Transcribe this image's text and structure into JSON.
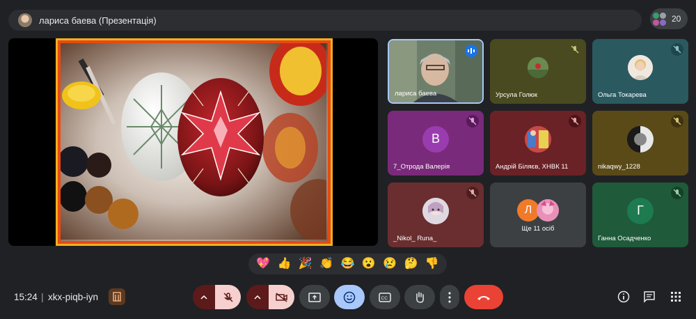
{
  "meeting": {
    "title": "лариса баева (Презентація)",
    "participant_count": "20",
    "time": "15:24",
    "separator": "|",
    "code": "xkx-piqb-iyn"
  },
  "tiles": [
    {
      "name": "лариса баева",
      "mic": "speaking-icon"
    },
    {
      "name": "Урсула Голюк",
      "mic": "mic-off-icon"
    },
    {
      "name": "Ольга Токарева",
      "mic": "mic-off-icon"
    },
    {
      "name": "7_Отрода Валерія",
      "mic": "mic-off-icon",
      "initial": "В"
    },
    {
      "name": "Андрій Біляєв, ХНВК 11",
      "mic": "mic-off-icon"
    },
    {
      "name": "nikaqwy_1228",
      "mic": "mic-off-icon"
    },
    {
      "name": "_Nikol_ Runa_",
      "mic": "mic-off-icon"
    },
    {
      "name": "Ще 11 осіб",
      "initial": "Л"
    },
    {
      "name": "Ганна Осадченко",
      "mic": "mic-off-icon",
      "initial": "Г"
    }
  ],
  "reactions": [
    "💖",
    "👍",
    "🎉",
    "👏",
    "😂",
    "😮",
    "😢",
    "🤔",
    "👎"
  ],
  "colors": {
    "background": "#202124",
    "end_call": "#ea4335",
    "reactions_active": "#a8c7fa"
  }
}
